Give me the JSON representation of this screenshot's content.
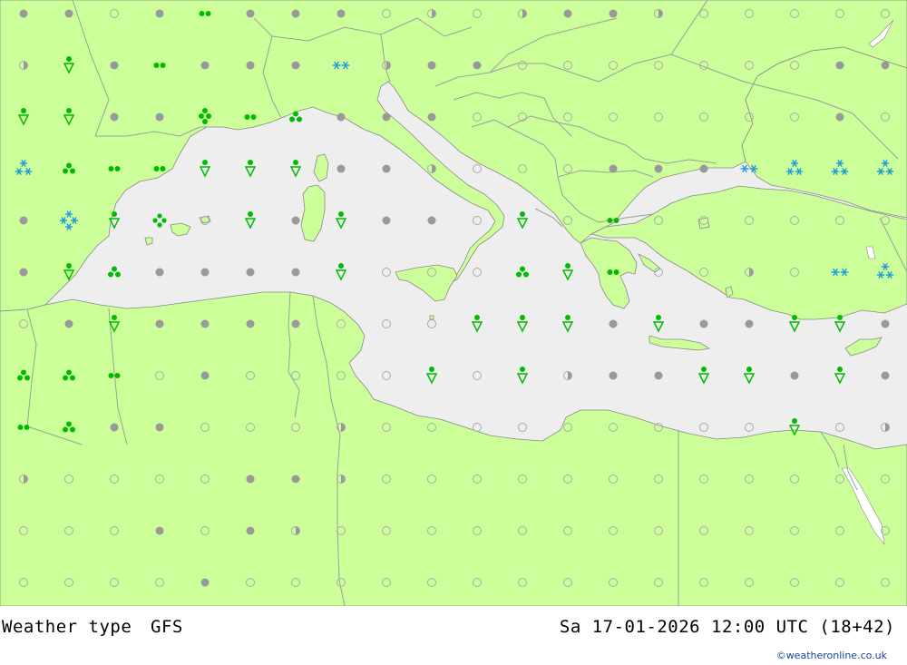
{
  "map": {
    "product": "Weather type",
    "model": "GFS",
    "valid_time": "Sa 17-01-2026 12:00 UTC (18+42)",
    "credit": "©weatheronline.co.uk",
    "colors": {
      "sea": "#eeeeee",
      "land": "#ccff99",
      "border": "#9aa09a",
      "coast": "#888888",
      "rain": "#00bb00",
      "snow": "#1e9bdc",
      "cloud": "#999999",
      "cloud_outline": "#aaaaaa"
    },
    "symbol_legend": {
      "clear": "clear sky",
      "partly": "partly cloudy",
      "cloudy": "overcast",
      "drizzle": "drizzle",
      "rain": "rain",
      "heavy-rain": "heavy rain",
      "rain-shower": "rain shower",
      "snow": "snow",
      "snow-shower": "snow shower",
      "sleet": "sleet shower",
      "heavy-snow": "heavy snow"
    },
    "grid_rows": [
      "C C O C D C C C O P O P C C P O O O O O",
      "P R C D C C C S P C C O O O O O O O C C",
      "R R C C H D T C C C O O O O O O O O C O",
      "N T D D R R R C C P O O O C C C S N N N",
      "C G R Q O R C R C C O R O D O O O O O O",
      "C R T C C C C R O O O T R D O O P O S N",
      "O C R C C C C O O O R R R C R C C R R C",
      "T T D O C O O O O R O R P C C R R C R C",
      "D T C C O O O P O O O O O O O O O R O P",
      "P O O O O C C P O O O O O O O O O O O O",
      "O O O C O C P O O O O O O O O O O O O O",
      "O O O O C O O O O O O O O O O O O O O O"
    ]
  }
}
